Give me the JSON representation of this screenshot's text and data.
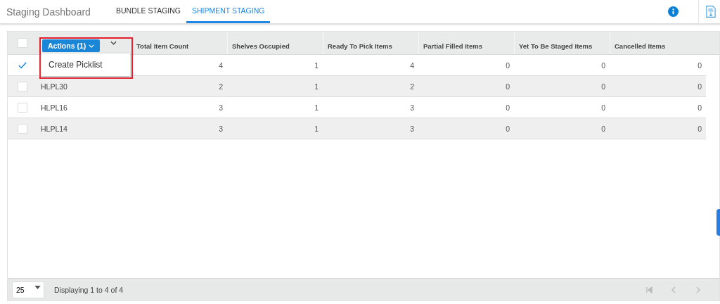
{
  "header": {
    "title": "Staging Dashboard",
    "tabs": [
      {
        "label": "BUNDLE STAGING",
        "selected": false
      },
      {
        "label": "SHIPMENT STAGING",
        "selected": true
      }
    ]
  },
  "table": {
    "header_checked": false,
    "actions_button": "Actions (1)",
    "columns": [
      "Total Item Count",
      "Shelves Occupied",
      "Ready To Pick Items",
      "Partial Filled Items",
      "Yet To Be Staged Items",
      "Cancelled Items"
    ],
    "rows": [
      {
        "checked": true,
        "cells": [
          "4",
          "1",
          "4",
          "0",
          "0",
          "0"
        ]
      },
      {
        "checked": false,
        "name": "HLPL30",
        "cells": [
          "2",
          "1",
          "2",
          "0",
          "0",
          "0"
        ]
      },
      {
        "checked": false,
        "name": "HLPL16",
        "cells": [
          "3",
          "1",
          "3",
          "0",
          "0",
          "0"
        ]
      },
      {
        "checked": false,
        "name": "HLPL14",
        "cells": [
          "3",
          "1",
          "3",
          "0",
          "0",
          "0"
        ]
      }
    ]
  },
  "actions_menu": {
    "items": [
      "Create Picklist"
    ]
  },
  "footer": {
    "page_size": "25",
    "summary": "Displaying 1 to 4 of 4"
  }
}
